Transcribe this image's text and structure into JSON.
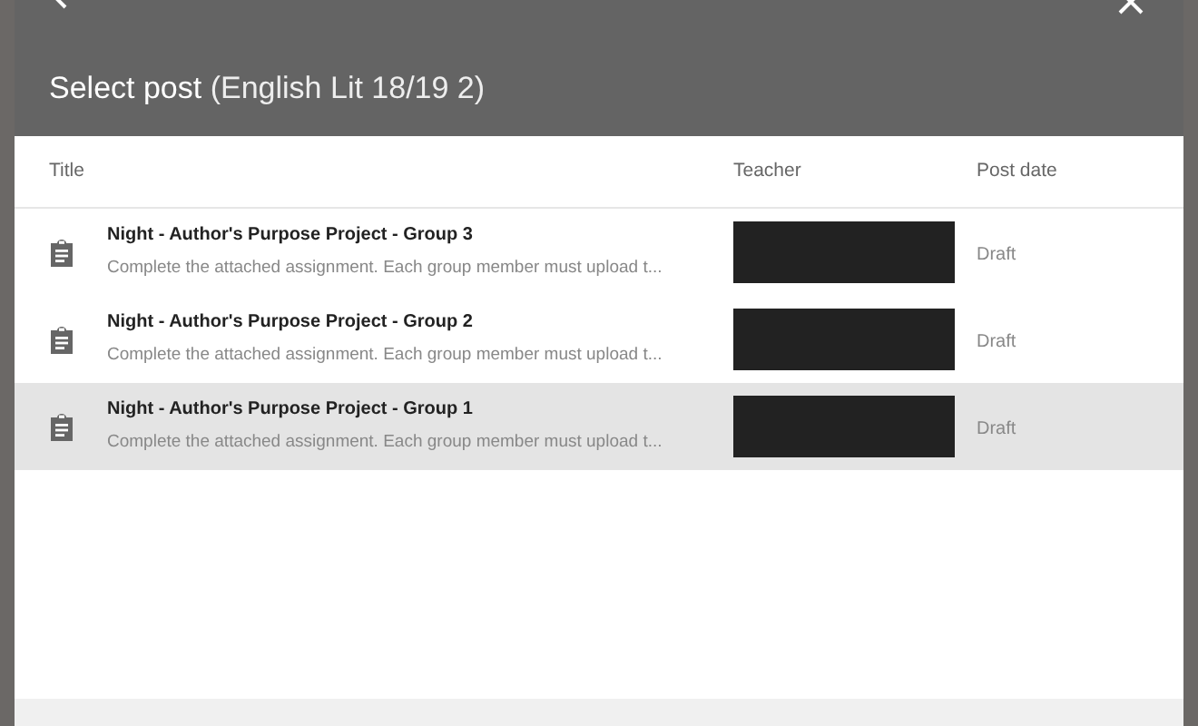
{
  "dialog": {
    "title": "Select post",
    "course": "(English Lit 18/19 2)"
  },
  "table": {
    "columns": [
      "Title",
      "Teacher",
      "Post date"
    ],
    "rows": [
      {
        "title": "Night - Author's Purpose Project - Group 3",
        "description": "Complete the attached assignment. Each group member must upload t...",
        "teacher_redacted": true,
        "post_date": "Draft",
        "selected": false
      },
      {
        "title": "Night - Author's Purpose Project - Group 2",
        "description": "Complete the attached assignment. Each group member must upload t...",
        "teacher_redacted": true,
        "post_date": "Draft",
        "selected": false
      },
      {
        "title": "Night - Author's Purpose Project - Group 1",
        "description": "Complete the attached assignment. Each group member must upload t...",
        "teacher_redacted": true,
        "post_date": "Draft",
        "selected": true
      }
    ]
  }
}
